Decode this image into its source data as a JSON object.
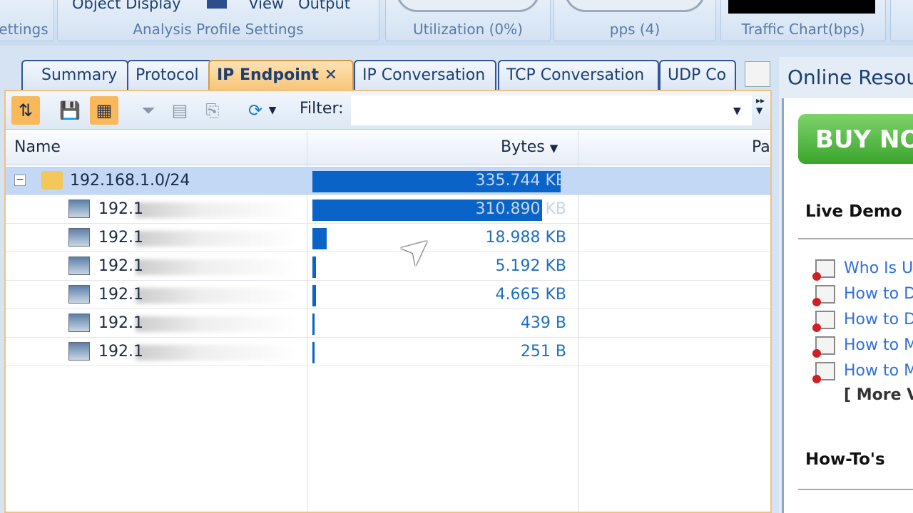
{
  "ribbon": {
    "groups": [
      {
        "label": "ettings"
      },
      {
        "label": "Analysis Profile Settings",
        "buttons": [
          "Object",
          "Display",
          "View",
          "Output"
        ]
      },
      {
        "label": "Utilization (0%)"
      },
      {
        "label": "pps (4)"
      },
      {
        "label": "Traffic Chart(bps)"
      }
    ]
  },
  "tabs": [
    {
      "label": "Summary",
      "active": false
    },
    {
      "label": "Protocol",
      "active": false
    },
    {
      "label": "IP Endpoint",
      "active": true
    },
    {
      "label": "IP Conversation",
      "active": false
    },
    {
      "label": "TCP Conversation",
      "active": false
    },
    {
      "label": "UDP Co",
      "active": false
    }
  ],
  "close_glyph": "✕",
  "toolbar": {
    "filter_label": "Filter:",
    "filter_value": ""
  },
  "table": {
    "columns": [
      "Name",
      "Bytes",
      "Pa"
    ],
    "sort_column": "Bytes",
    "sort_direction": "descending",
    "rows": [
      {
        "name": "192.168.1.0/24",
        "bytes": "335.744 KB",
        "bytes_value": 335744,
        "group": true
      },
      {
        "name": "192.1",
        "bytes": "310.890 KB",
        "bytes_value": 310890
      },
      {
        "name": "192.1",
        "bytes": "18.988 KB",
        "bytes_value": 18988
      },
      {
        "name": "192.1",
        "bytes": "5.192 KB",
        "bytes_value": 5192
      },
      {
        "name": "192.1",
        "bytes": "4.665 KB",
        "bytes_value": 4665
      },
      {
        "name": "192.1",
        "bytes": "439  B",
        "bytes_value": 439
      },
      {
        "name": "192.1",
        "bytes": "251  B",
        "bytes_value": 251
      }
    ]
  },
  "online": {
    "title": "Online Resou",
    "buy": "BUY NO",
    "live_demo": "Live Demo",
    "links": [
      "Who Is Us",
      "How to De",
      "How to De",
      "How to Mo",
      "How to Mo"
    ],
    "more": "[ More Vi",
    "howtos": "How-To's"
  },
  "colors": {
    "accent": "#f9b85a",
    "bar": "#0a64c8",
    "link": "#2f6fe0",
    "buy": "#4cb63a"
  }
}
